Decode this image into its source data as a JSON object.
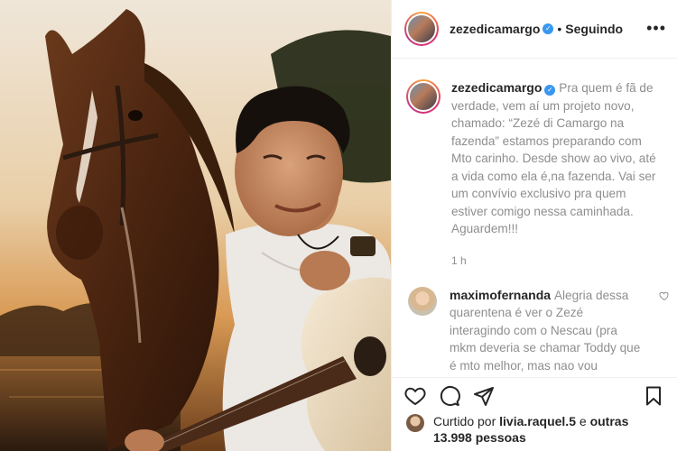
{
  "post": {
    "username": "zezedicamargo",
    "verified_mark": "✓",
    "separator": "•",
    "follow_status": "Seguindo",
    "more_label": "•••",
    "caption": "Pra quem é fã de verdade, vem aí um projeto novo, chamado: “Zezé di Camargo na fazenda” estamos preparando com Mto carinho. Desde show ao vivo, até a vida como ela é,na fazenda. Vai ser um convívio exclusivo pra quem estiver comigo nessa caminhada. Aguardem!!!",
    "time_ago": "1 h"
  },
  "comments": [
    {
      "username": "maximofernanda",
      "text": "Alegria dessa quarentena é ver o Zezé interagindo com o Nescau (pra mkm deveria se chamar Toddy que é mto melhor, mas nao vou contrariar o netinho) rsrs....aliás, Zezé sendo gente como a gente"
    }
  ],
  "likes": {
    "prefix": "Curtido por",
    "liker": "livia.raquel.5",
    "conj": "e",
    "others": "outras 13.998 pessoas"
  },
  "icons": {
    "like": "heart-icon",
    "comment": "comment-bubble-icon",
    "share": "paper-plane-icon",
    "save": "bookmark-icon",
    "verified": "verified-badge-icon"
  },
  "colors": {
    "verified_blue": "#3897f0",
    "secondary_text": "#8e8e8e",
    "primary_text": "#262626",
    "border": "#efefef"
  }
}
